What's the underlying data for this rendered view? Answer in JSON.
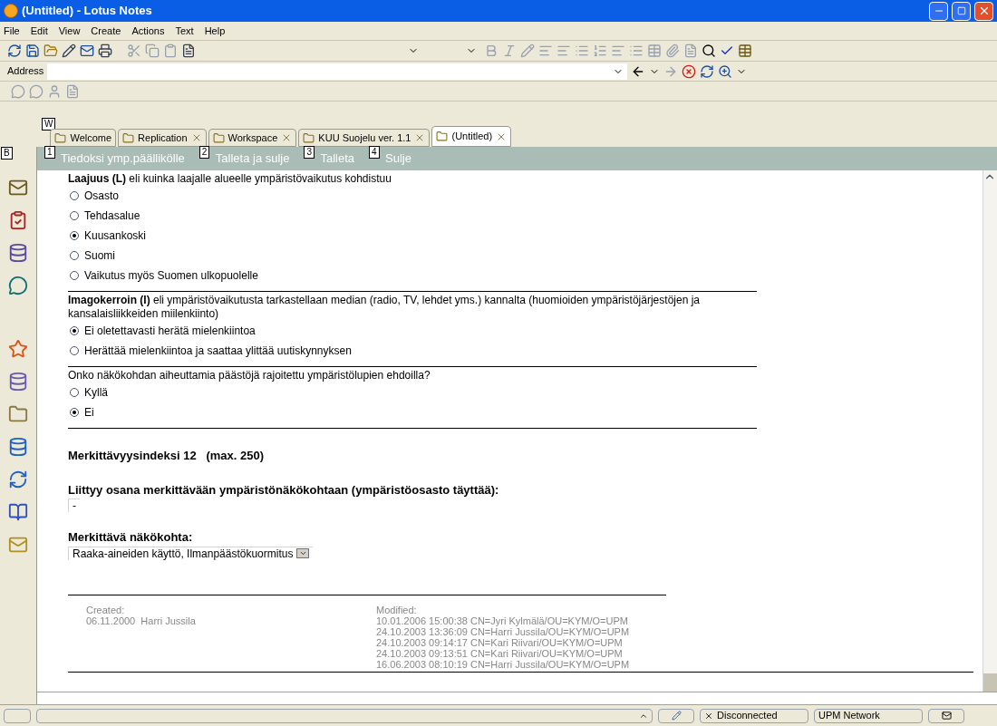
{
  "window": {
    "title": "(Untitled) - Lotus Notes"
  },
  "menu": [
    "File",
    "Edit",
    "View",
    "Create",
    "Actions",
    "Text",
    "Help"
  ],
  "address": {
    "label": "Address"
  },
  "tabs": [
    {
      "label": "Welcome",
      "hint": "W",
      "closable": false,
      "selected": false
    },
    {
      "label": "Replication",
      "closable": true,
      "selected": false
    },
    {
      "label": "Workspace",
      "closable": true,
      "selected": false
    },
    {
      "label": "KUU Suojelu ver. 1.1",
      "closable": true,
      "selected": false
    },
    {
      "label": "(Untitled)",
      "closable": true,
      "selected": true
    }
  ],
  "sidebar": {
    "hint": "B"
  },
  "actions": [
    {
      "number": "1",
      "label": "Tiedoksi ymp.päällikölle"
    },
    {
      "number": "2",
      "label": "Talleta ja sulje"
    },
    {
      "number": "3",
      "label": "Talleta"
    },
    {
      "number": "4",
      "label": "Sulje"
    }
  ],
  "questions": [
    {
      "heading": "**Laajuus (L)** eli kuinka laajalle alueelle ympäristövaikutus kohdistuu",
      "options": [
        {
          "label": "Osasto",
          "selected": false
        },
        {
          "label": "Tehdasalue",
          "selected": false
        },
        {
          "label": "Kuusankoski",
          "selected": true
        },
        {
          "label": "Suomi",
          "selected": false
        },
        {
          "label": "Vaikutus myös Suomen ulkopuolelle",
          "selected": false
        }
      ]
    },
    {
      "heading": "**Imagokerroin (I)** eli ympäristövaikutusta tarkastellaan median (radio, TV, lehdet yms.) kannalta (huomioiden ympäristöjärjestöjen ja kansalaisliikkeiden miilenkiinto)",
      "options": [
        {
          "label": "Ei oletettavasti herätä mielenkiintoa",
          "selected": true
        },
        {
          "label": "Herättää mielenkiintoa ja saattaa ylittää uutiskynnyksen",
          "selected": false
        }
      ]
    },
    {
      "heading": "Onko näkökohdan aiheuttamia päästöjä rajoitettu ympäristölupien ehdoilla?",
      "options": [
        {
          "label": "Kyllä",
          "selected": false
        },
        {
          "label": "Ei",
          "selected": true
        }
      ]
    }
  ],
  "index": "Merkittävyysindeksi 12   (max. 250)",
  "fields": [
    {
      "label": "Liittyy osana merkittävään ympäristönäkökohtaan (ympäristöosasto täyttää):",
      "value": "-",
      "dropdown": false
    },
    {
      "label": "Merkittävä näkökohta:",
      "value": "Raaka-aineiden käyttö, Ilmanpäästökuormitus",
      "dropdown": true
    }
  ],
  "footer": {
    "created_label": "Created:",
    "created": "06.11.2000  Harri Jussila",
    "modified_label": "Modified:",
    "modified": [
      "10.01.2006 15:00:38 CN=Jyri Kylmälä/OU=KYM/O=UPM",
      "24.10.2003 13:36:09 CN=Harri Jussila/OU=KYM/O=UPM",
      "24.10.2003 09:14:17 CN=Kari Riivari/OU=KYM/O=UPM",
      "24.10.2003 09:13:51 CN=Kari Riivari/OU=KYM/O=UPM",
      "16.06.2003 08:10:19 CN=Harri Jussila/OU=KYM/O=UPM"
    ]
  },
  "status_bar": {
    "connection": "Disconnected",
    "location": "UPM Network"
  }
}
